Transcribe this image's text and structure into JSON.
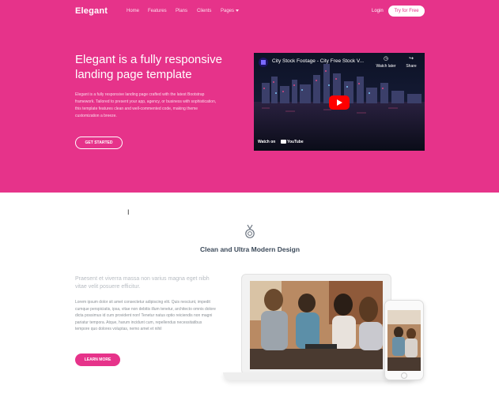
{
  "colors": {
    "accent": "#e6338a",
    "heading": "#3c4a5a",
    "muted": "#b7bcc2",
    "body": "#8a9096"
  },
  "nav": {
    "brand": "Elegant",
    "links": [
      {
        "label": "Home"
      },
      {
        "label": "Features"
      },
      {
        "label": "Plans"
      },
      {
        "label": "Clients"
      },
      {
        "label": "Pages"
      }
    ],
    "login": "Login",
    "cta": "Try for Free"
  },
  "hero": {
    "title": "Elegant is a fully responsive landing page template",
    "text": "Elegant is a fully responsive landing page crafted with the latest Bootstrap framework. Tailored to present your app, agency, or business with sophistication, this template features clean and well-commented code, making theme customization a breeze.",
    "button": "GET STARTED"
  },
  "video": {
    "title": "City Stock Footage - City Free Stock V...",
    "watch_later": "Watch later",
    "share": "Share",
    "watch_on": "Watch on",
    "youtube": "YouTube"
  },
  "section": {
    "icon": "medal-icon",
    "title": "Clean and Ultra Modern Design",
    "lead": "Praesent et viverra massa non varius magna eget nibh vitae velit posuere efficitur.",
    "body": "Lorem ipsum dolor sit amet consectetur adipiscing elit. Quis nesciunt, impedit cumque perspiciatis, ipsa, vitae non debitis illum tenetur, architecto omnis dolore dicta possimus id cum provident non! Tenetur natus optio reiciendis non magni pariatur tempora. Atque, harum incidunt cum, repellendus necessitatibus tempore quo dolores voluptas, nemo amet et nihil",
    "button": "LEARN MORE"
  }
}
